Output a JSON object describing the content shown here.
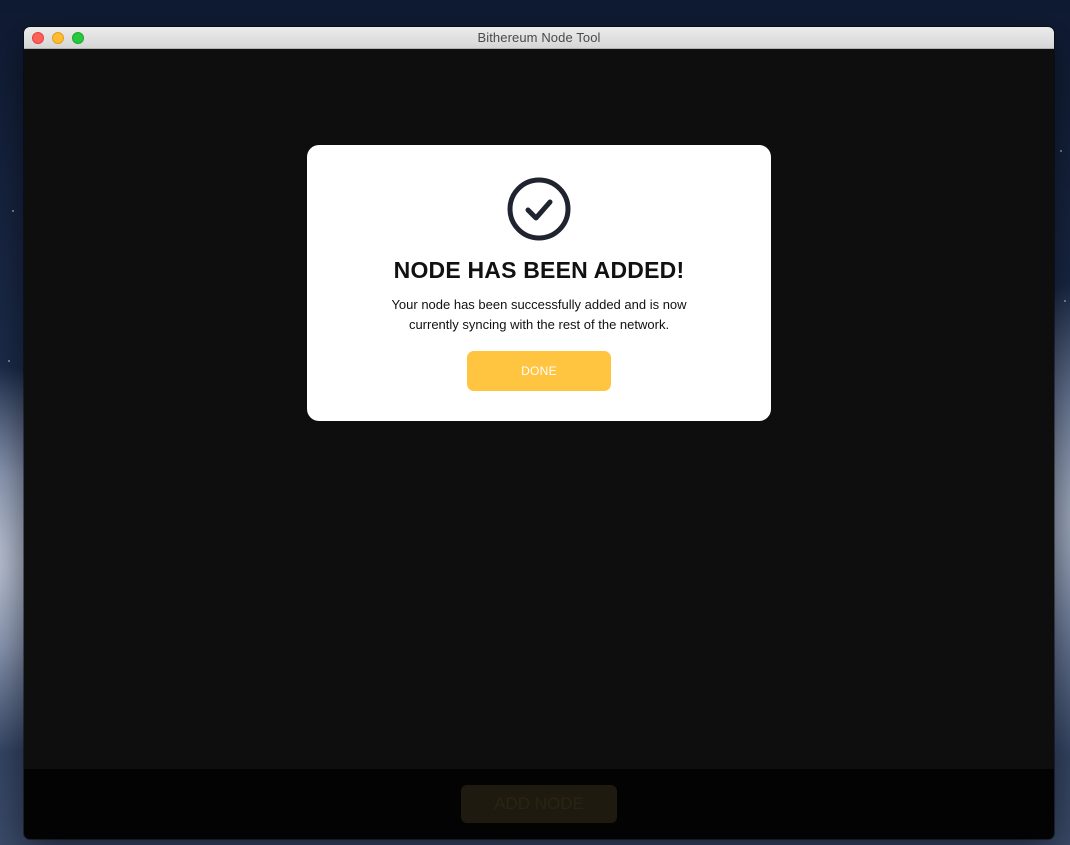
{
  "window": {
    "title": "Bithereum Node Tool"
  },
  "modal": {
    "icon": "check-circle-icon",
    "title": "NODE HAS BEEN ADDED!",
    "message": "Your node has been successfully added and is now currently syncing with the rest of the network.",
    "done_label": "DONE"
  },
  "footer": {
    "add_node_label": "ADD NODE"
  },
  "colors": {
    "accent": "#ffc440",
    "modal_background": "#ffffff",
    "app_background": "#0e0e0f"
  }
}
